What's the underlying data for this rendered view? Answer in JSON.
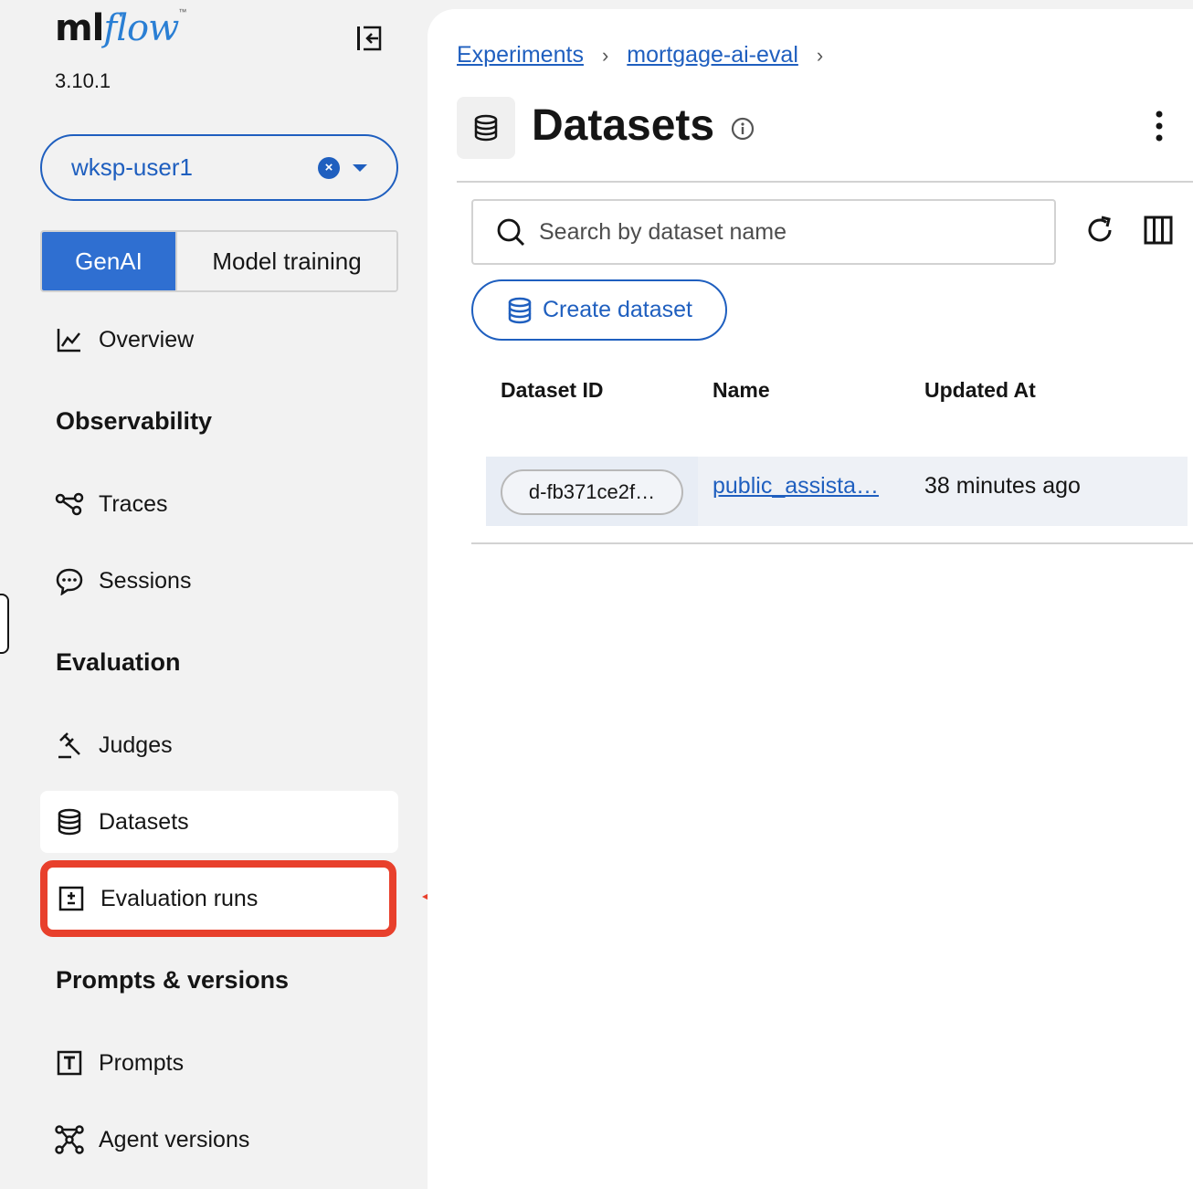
{
  "app": {
    "logo_ml": "ml",
    "logo_flow": "flow",
    "logo_tm": "™",
    "version": "3.10.1"
  },
  "workspace": {
    "value": "wksp-user1"
  },
  "mode_toggle": {
    "genai_label": "GenAI",
    "model_training_label": "Model training",
    "active": "GenAI"
  },
  "sidebar": {
    "overview": "Overview",
    "observability_title": "Observability",
    "traces": "Traces",
    "sessions": "Sessions",
    "evaluation_title": "Evaluation",
    "judges": "Judges",
    "datasets": "Datasets",
    "evaluation_runs": "Evaluation runs",
    "prompts_title": "Prompts & versions",
    "prompts": "Prompts",
    "agent_versions": "Agent versions"
  },
  "breadcrumb": {
    "items": [
      "Experiments",
      "mortgage-ai-eval"
    ]
  },
  "page": {
    "title": "Datasets"
  },
  "search": {
    "placeholder": "Search by dataset name",
    "value": ""
  },
  "actions": {
    "create_label": "Create dataset"
  },
  "table": {
    "columns": [
      "Dataset ID",
      "Name",
      "Updated At"
    ],
    "rows": [
      {
        "dataset_id": "d-fb371ce2f…",
        "name": "public_assista…",
        "updated_at": "38 minutes ago"
      }
    ]
  },
  "colors": {
    "accent": "#1f5fbf",
    "highlight": "#e8402c"
  }
}
